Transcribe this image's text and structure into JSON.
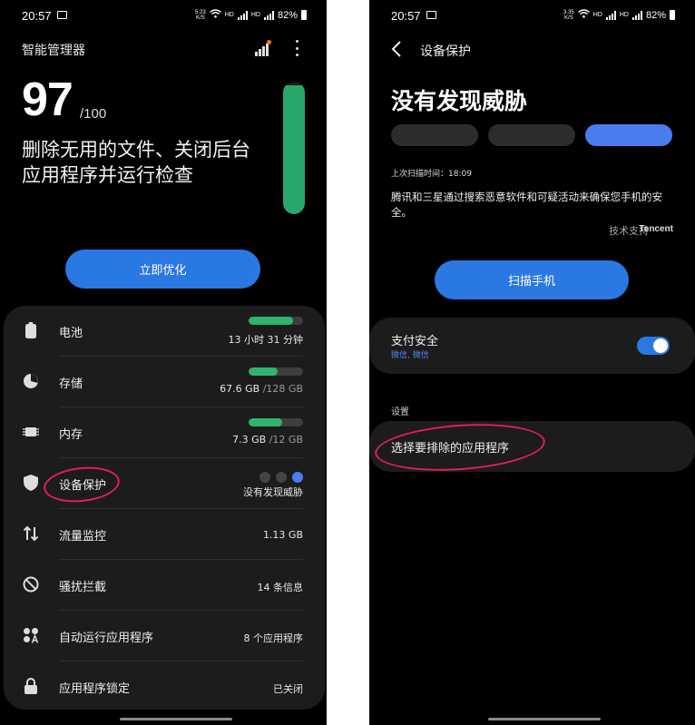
{
  "left": {
    "status": {
      "time": "20:57",
      "speed": "5.23\nK/S",
      "net_a": "HD",
      "net_b": "HD",
      "battery": "82%"
    },
    "app_title": "智能管理器",
    "score": {
      "value": "97",
      "max": "/100",
      "level": 0.97
    },
    "description": "删除无用的文件、关闭后台应用程序并运行检查",
    "optimize_button": "立即优化",
    "items": [
      {
        "label": "电池",
        "value": "13 小时 31 分钟",
        "value_sub": "",
        "progress": 0.82,
        "icon": "battery-icon"
      },
      {
        "label": "存储",
        "value": "67.6 GB",
        "value_sub": "/128 GB",
        "progress": 0.53,
        "icon": "storage-icon"
      },
      {
        "label": "内存",
        "value": "7.3 GB",
        "value_sub": "/12 GB",
        "progress": 0.61,
        "icon": "memory-icon"
      },
      {
        "label": "设备保护",
        "value": "没有发现威胁",
        "value_sub": "",
        "icon": "shield-icon"
      },
      {
        "label": "流量监控",
        "value": "1.13 GB",
        "value_sub": "",
        "icon": "data-transfer-icon"
      },
      {
        "label": "骚扰拦截",
        "value": "14 条信息",
        "value_sub": "",
        "icon": "block-icon"
      },
      {
        "label": "自动运行应用程序",
        "value": "8 个应用程序",
        "value_sub": "",
        "icon": "auto-run-apps-icon"
      },
      {
        "label": "应用程序锁定",
        "value": "已关闭",
        "value_sub": "",
        "icon": "lock-icon"
      }
    ]
  },
  "right": {
    "status": {
      "time": "20:57",
      "speed": "3.35\nK/S",
      "net_a": "HD",
      "net_b": "HD",
      "battery": "82%"
    },
    "header": "设备保护",
    "title": "没有发现威胁",
    "last_scan": "上次扫描时间：18:09",
    "info": "腾讯和三星通过搜索恶意软件和可疑活动来确保您手机的安全。",
    "support_label": "技术支持",
    "support_brand": "Tencent",
    "scan_button": "扫描手机",
    "payment": {
      "title": "支付安全",
      "subtitle": "微信, 微信",
      "enabled": true
    },
    "settings_header": "设置",
    "exclude_label": "选择要排除的应用程序"
  },
  "colors": {
    "accent_blue": "#2a78e2",
    "green": "#2fb36f",
    "annotation_red": "#e21e5c",
    "card": "#1c1c1c"
  }
}
